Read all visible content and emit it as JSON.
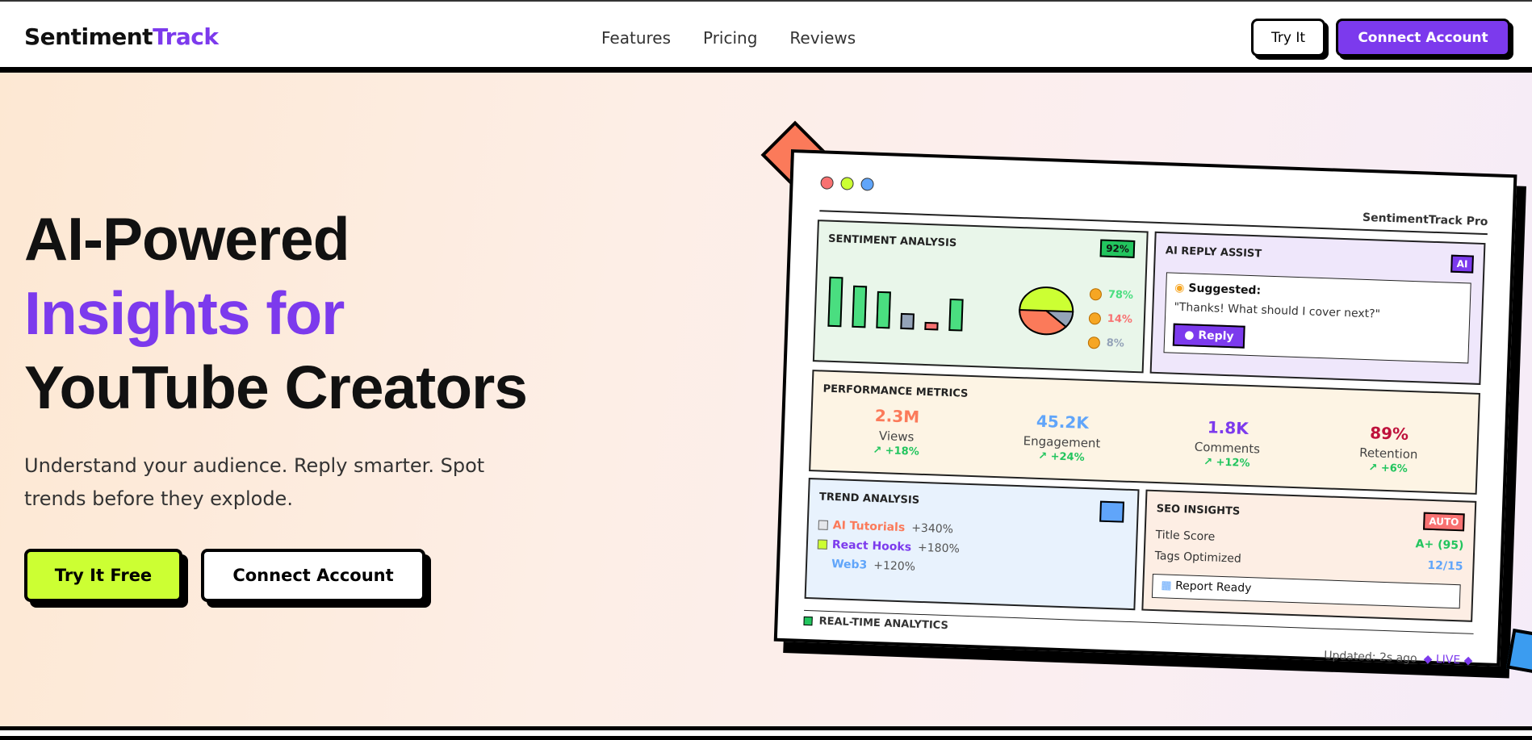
{
  "nav": {
    "logo_main": "Sentiment",
    "logo_accent": "Track",
    "links": [
      "Features",
      "Pricing",
      "Reviews"
    ],
    "try_label": "Try It",
    "connect_label": "Connect Account"
  },
  "hero": {
    "line1": "AI-Powered",
    "line2": "Insights for",
    "line3": "YouTube Creators",
    "subtitle": "Understand your audience. Reply smarter. Spot trends before they explode.",
    "cta_primary": "Try It Free",
    "cta_secondary": "Connect Account"
  },
  "dashboard": {
    "title": "SentimentTrack Pro",
    "sentiment": {
      "heading": "SENTIMENT ANALYSIS",
      "score": "92%",
      "legend": [
        "78%",
        "14%",
        "8%"
      ]
    },
    "ai_reply": {
      "heading": "AI REPLY ASSIST",
      "badge": "AI",
      "suggested": "Suggested:",
      "quote": "\"Thanks! What should I cover next?\"",
      "reply_label": "Reply"
    },
    "performance": {
      "heading": "PERFORMANCE METRICS",
      "metrics": [
        {
          "value": "2.3M",
          "label": "Views",
          "change": "↗ +18%"
        },
        {
          "value": "45.2K",
          "label": "Engagement",
          "change": "↗ +24%"
        },
        {
          "value": "1.8K",
          "label": "Comments",
          "change": "↗ +12%"
        },
        {
          "value": "89%",
          "label": "Retention",
          "change": "↗ +6%"
        }
      ]
    },
    "trend": {
      "heading": "TREND ANALYSIS",
      "items": [
        {
          "name": "AI Tutorials",
          "pct": "+340%"
        },
        {
          "name": "React Hooks",
          "pct": "+180%"
        },
        {
          "name": "Web3",
          "pct": "+120%"
        }
      ]
    },
    "seo": {
      "heading": "SEO INSIGHTS",
      "badge": "AUTO",
      "title_score_label": "Title Score",
      "title_score_value": "A+ (95)",
      "tags_label": "Tags Optimized",
      "tags_value": "12/15",
      "report": "Report Ready"
    },
    "realtime": "REAL-TIME ANALYTICS",
    "updated": "Updated: 2s ago",
    "live": "◆ LIVE ◆"
  },
  "colors": {
    "accent": "#7c3aed",
    "lime": "#ccff33",
    "coral": "#fb7a5a",
    "green": "#22c55e"
  }
}
